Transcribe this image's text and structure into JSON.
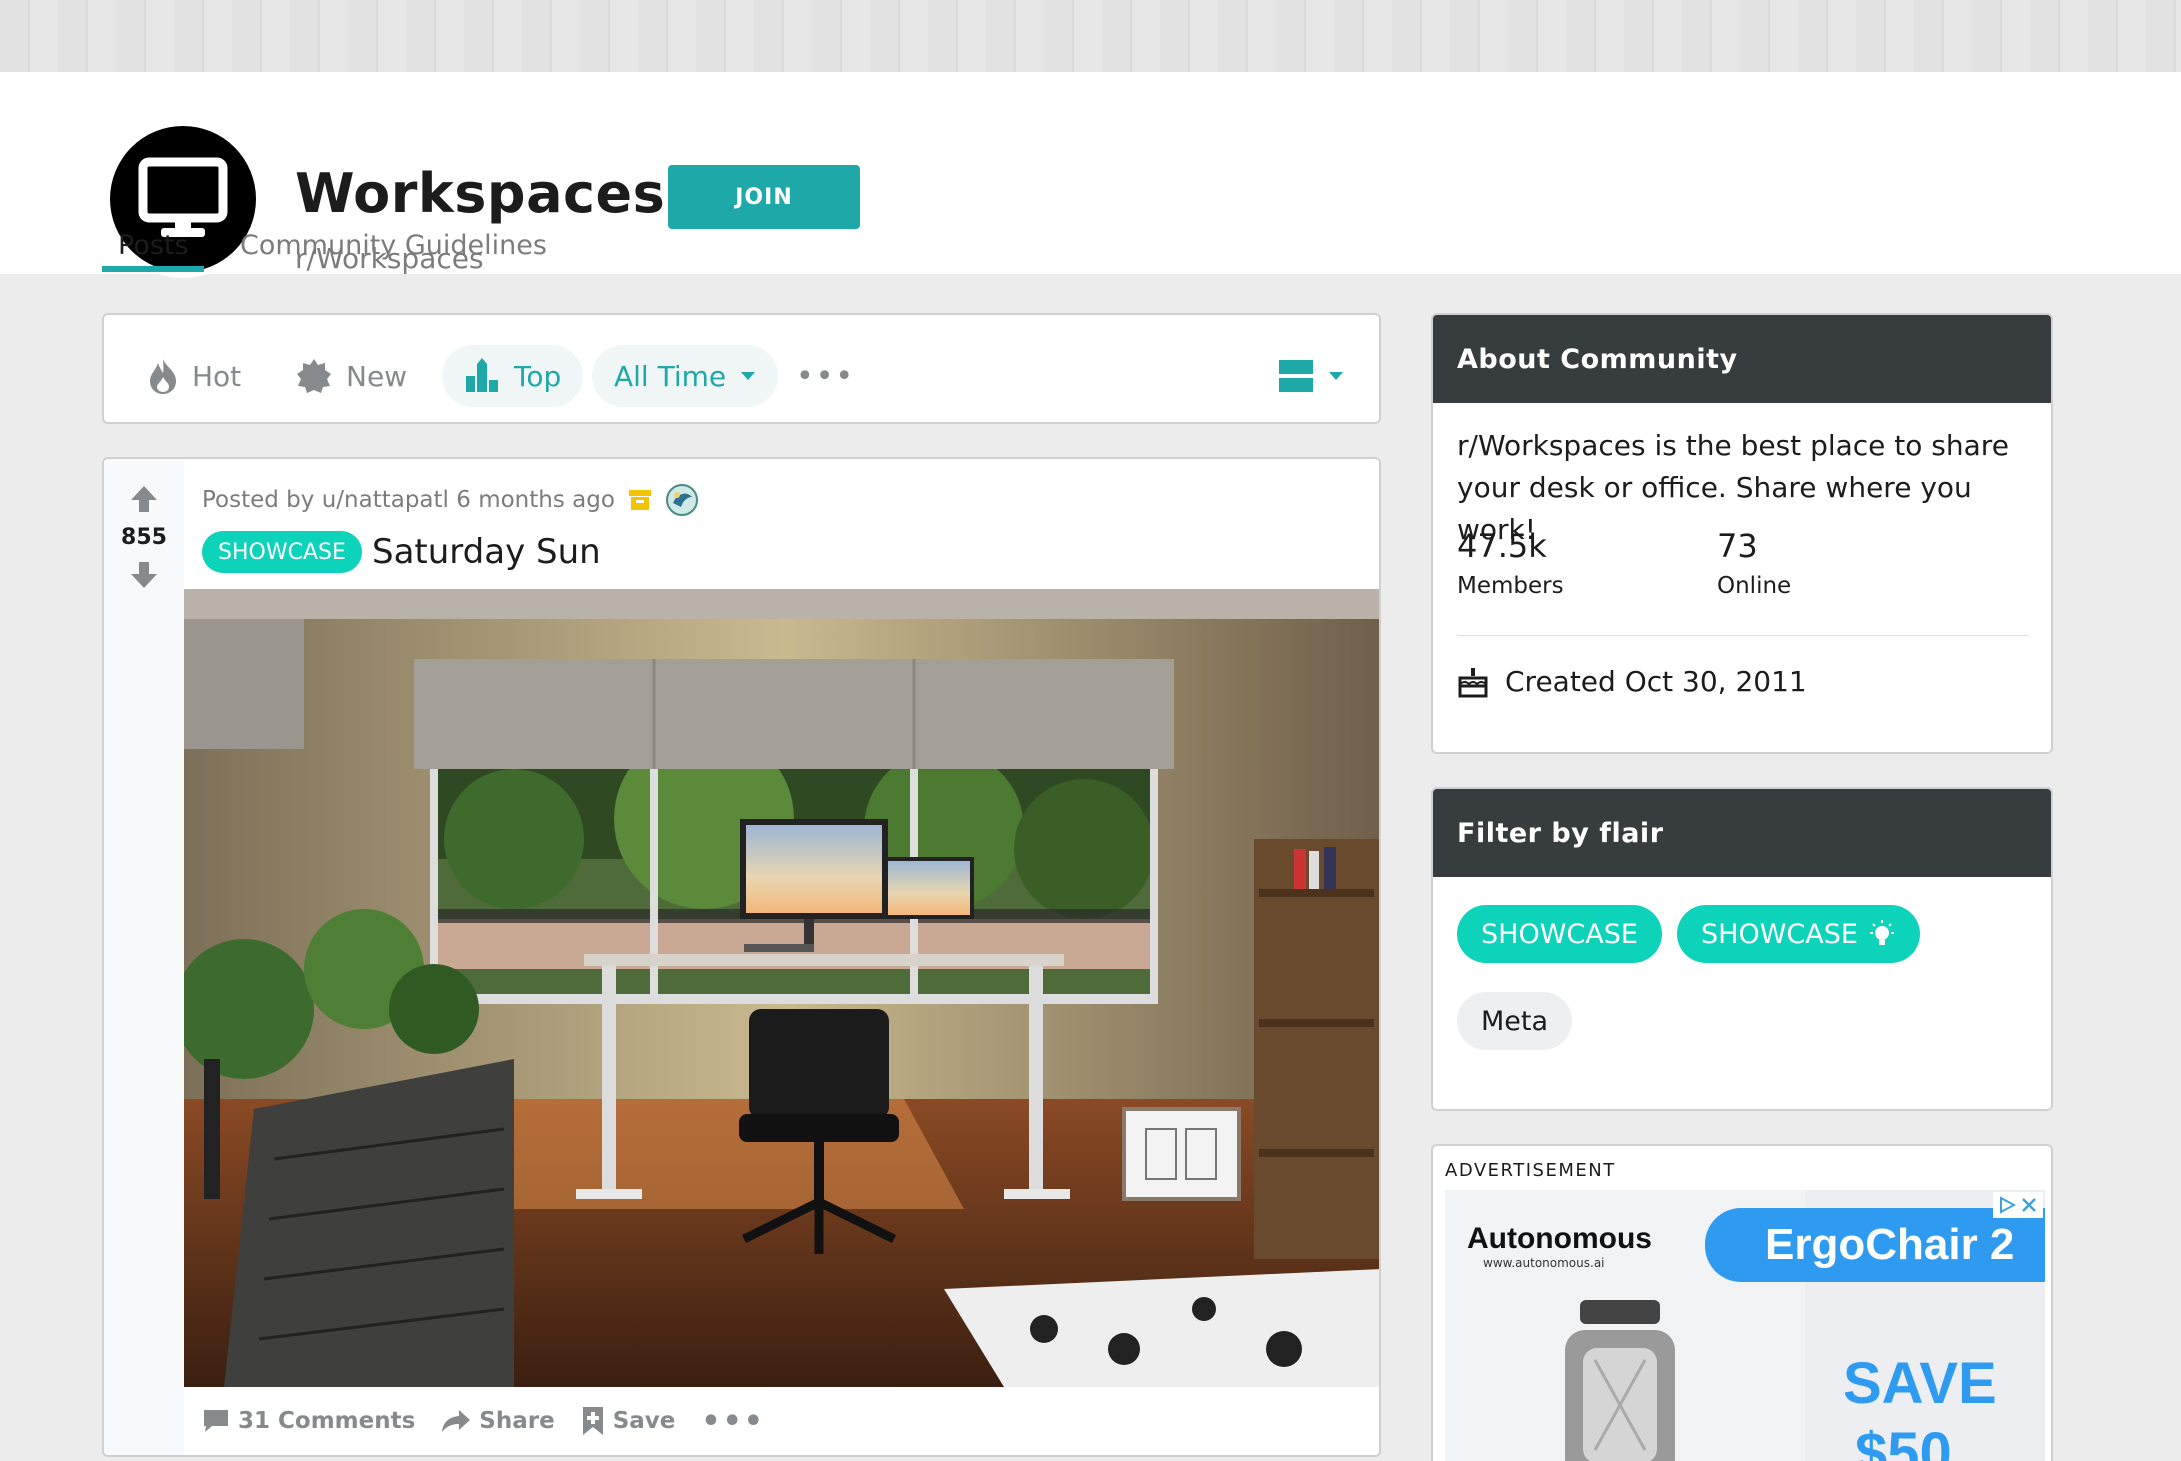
{
  "community": {
    "name": "Workspaces",
    "handle": "r/Workspaces",
    "join_label": "JOIN"
  },
  "tabs": [
    {
      "label": "Posts",
      "active": true
    },
    {
      "label": "Community Guidelines",
      "active": false
    }
  ],
  "sort": {
    "hot": "Hot",
    "new": "New",
    "top": "Top",
    "time_range": "All Time",
    "more": "•••"
  },
  "post": {
    "votes": "855",
    "posted_by": "Posted by u/nattapatl 6 months ago",
    "flair": "SHOWCASE",
    "title": "Saturday Sun",
    "comments_label": "31 Comments",
    "share_label": "Share",
    "save_label": "Save",
    "more": "•••"
  },
  "about": {
    "header": "About Community",
    "description": "r/Workspaces is the best place to share your desk or office. Share where you work!",
    "members_count": "47.5k",
    "members_label": "Members",
    "online_count": "73",
    "online_label": "Online",
    "created": "Created Oct 30, 2011"
  },
  "flair_filter": {
    "header": "Filter by flair",
    "flairs": [
      "SHOWCASE",
      "SHOWCASE",
      "Meta"
    ]
  },
  "advertisement": {
    "label": "ADVERTISEMENT",
    "brand": "Autonomous",
    "brand_url": "www.autonomous.ai",
    "product": "ErgoChair 2",
    "promo": "SAVE",
    "promo_amount": "$50"
  },
  "colors": {
    "accent": "#1ea8a8",
    "flair": "#0dd3bb",
    "widget_header": "#373c3f"
  }
}
